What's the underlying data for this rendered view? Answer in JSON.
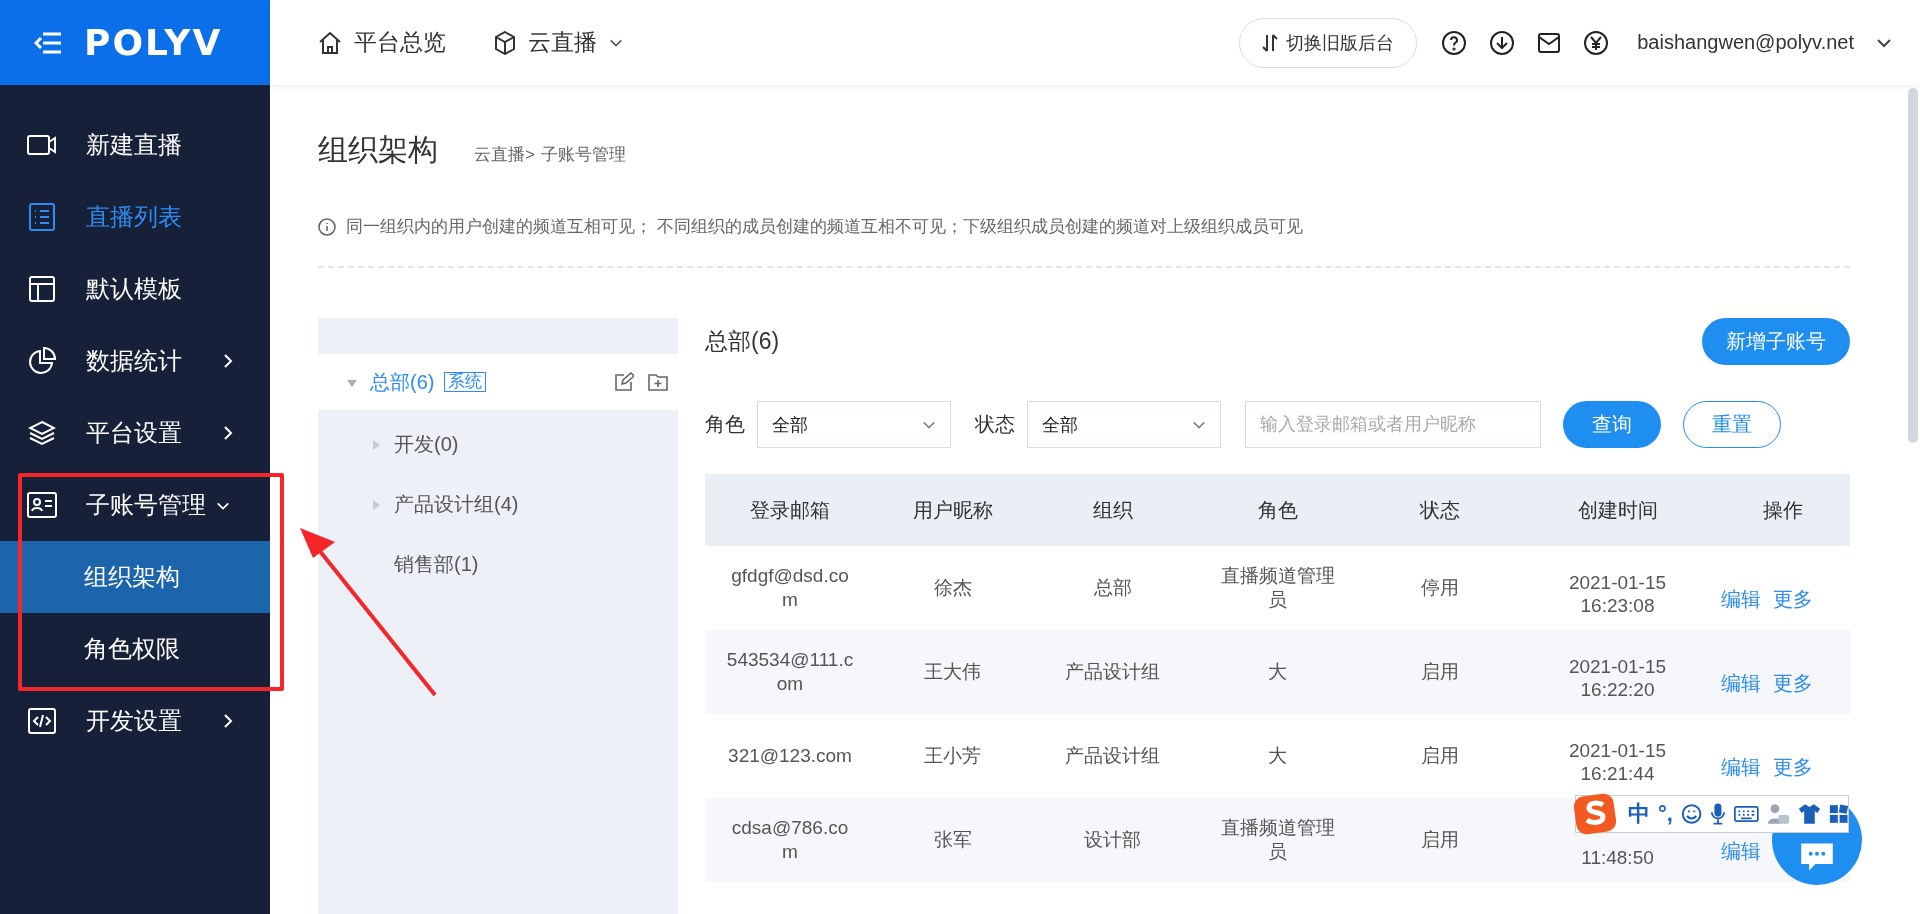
{
  "logo": {
    "text": "POLYV"
  },
  "top_nav": [
    {
      "kind": "home",
      "label": "平台总览",
      "dropdown": false
    },
    {
      "kind": "cube",
      "label": "云直播",
      "dropdown": true
    }
  ],
  "switch_button": {
    "label": "切换旧版后台"
  },
  "user": {
    "email": "baishangwen@polyv.net"
  },
  "sidebar": {
    "items": [
      {
        "kind": "video",
        "label": "新建直播",
        "highlighted": false,
        "selected": false,
        "expandable": false
      },
      {
        "kind": "list",
        "label": "直播列表",
        "highlighted": true,
        "selected": false,
        "expandable": false
      },
      {
        "kind": "template",
        "label": "默认模板",
        "highlighted": false,
        "selected": false,
        "expandable": false
      },
      {
        "kind": "chart",
        "label": "数据统计",
        "highlighted": false,
        "selected": false,
        "expandable": true,
        "expanded": false
      },
      {
        "kind": "layers",
        "label": "平台设置",
        "highlighted": false,
        "selected": false,
        "expandable": true,
        "expanded": false
      },
      {
        "kind": "idcard",
        "label": "子账号管理",
        "highlighted": false,
        "selected": false,
        "expandable": true,
        "expanded": true,
        "children": [
          {
            "label": "组织架构",
            "selected": true
          },
          {
            "label": "角色权限",
            "selected": false
          }
        ]
      },
      {
        "kind": "code",
        "label": "开发设置",
        "highlighted": false,
        "selected": false,
        "expandable": true,
        "expanded": false
      }
    ]
  },
  "page": {
    "title": "组织架构",
    "breadcrumb": [
      "云直播>",
      "子账号管理"
    ],
    "notice": "同一组织内的用户创建的频道互相可见； 不同组织的成员创建的频道互相不可见；下级组织成员创建的频道对上级组织成员可见"
  },
  "tree": {
    "nodes": [
      {
        "label": "总部(6)",
        "tag": "系统",
        "selected": true,
        "expanded": true,
        "children": [
          {
            "label": "开发(0)",
            "has_children": true,
            "selected": false
          },
          {
            "label": "产品设计组(4)",
            "has_children": true,
            "selected": false
          },
          {
            "label": "销售部(1)",
            "has_children": false,
            "selected": false
          }
        ]
      }
    ]
  },
  "panel": {
    "title": "总部(6)",
    "add_button": "新增子账号",
    "filters": [
      {
        "label": "角色",
        "value": "全部"
      },
      {
        "label": "状态",
        "value": "全部"
      }
    ],
    "search": {
      "placeholder": "输入登录邮箱或者用户昵称"
    },
    "query_button": "查询",
    "reset_button": "重置"
  },
  "table": {
    "columns": [
      "登录邮箱",
      "用户昵称",
      "组织",
      "角色",
      "状态",
      "创建时间",
      "操作"
    ],
    "rows": [
      {
        "cells": [
          "gfdgf@dsd.com",
          "徐杰",
          "总部",
          "直播频道管理员",
          "停用",
          "2021-01-15 16:23:08"
        ],
        "actions": [
          "编辑",
          "更多"
        ]
      },
      {
        "cells": [
          "543534@111.com",
          "王大伟",
          "产品设计组",
          "大",
          "启用",
          "2021-01-15 16:22:20"
        ],
        "actions": [
          "编辑",
          "更多"
        ]
      },
      {
        "cells": [
          "321@123.com",
          "王小芳",
          "产品设计组",
          "大",
          "启用",
          "2021-01-15 16:21:44"
        ],
        "actions": [
          "编辑",
          "更多"
        ]
      },
      {
        "cells": [
          "cdsa@786.com",
          "张军",
          "设计部",
          "直播频道管理员",
          "启用",
          "11:48:50"
        ],
        "actions": [
          "编辑"
        ]
      }
    ]
  },
  "ime_toolbar": {
    "mode": "中",
    "punct": "°,"
  }
}
